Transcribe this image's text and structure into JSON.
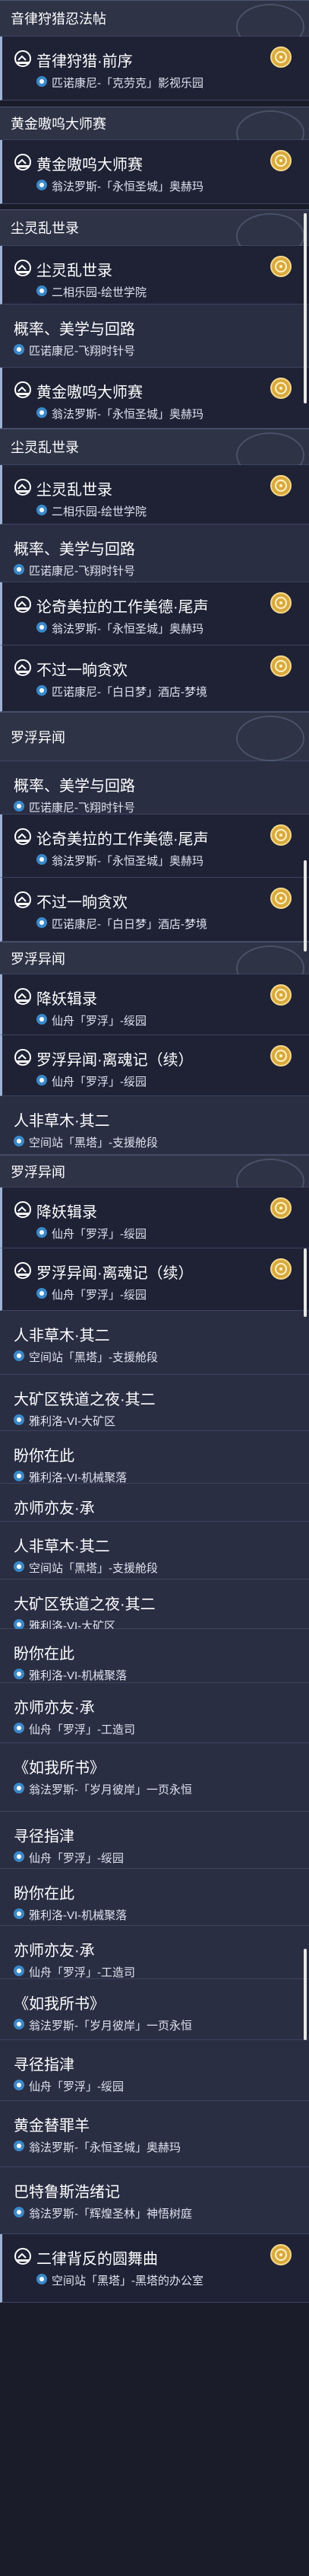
{
  "items": [
    {
      "header": "音律狩猎忍法帖"
    },
    {
      "title": "音律狩猎·前序",
      "location": "匹诺康尼-「克劳克」影视乐园",
      "selected": true
    },
    {
      "header": "黄金嗷呜大师赛"
    },
    {
      "title": "黄金嗷呜大师赛",
      "location": "翁法罗斯-「永恒圣城」奥赫玛",
      "selected": true
    },
    {
      "header": "尘灵乱世录"
    },
    {
      "title": "尘灵乱世录",
      "location": "二相乐园-绘世学院",
      "selected": true
    },
    {
      "title": "概率、美学与回路",
      "location": "匹诺康尼-飞翔时针号",
      "selected": false
    },
    {
      "title": "黄金嗷呜大师赛",
      "location": "翁法罗斯-「永恒圣城」奥赫玛",
      "selected": true
    },
    {
      "header": "尘灵乱世录"
    },
    {
      "title": "尘灵乱世录",
      "location": "二相乐园-绘世学院",
      "selected": true
    },
    {
      "title": "概率、美学与回路",
      "location": "匹诺康尼-飞翔时针号",
      "selected": false
    },
    {
      "title": "论奇美拉的工作美德·尾声",
      "location": "翁法罗斯-「永恒圣城」奥赫玛",
      "selected": true
    },
    {
      "title": "不过一晌贪欢",
      "location": "匹诺康尼-「白日梦」酒店-梦境",
      "selected": true
    },
    {
      "header": "罗浮异闻"
    },
    {
      "title": "概率、美学与回路",
      "location": "匹诺康尼-飞翔时针号",
      "selected": false
    },
    {
      "title": "论奇美拉的工作美德·尾声",
      "location": "翁法罗斯-「永恒圣城」奥赫玛",
      "selected": true
    },
    {
      "title": "不过一晌贪欢",
      "location": "匹诺康尼-「白日梦」酒店-梦境",
      "selected": true
    },
    {
      "header": "罗浮异闻"
    },
    {
      "title": "降妖辑录",
      "location": "仙舟「罗浮」-绥园",
      "selected": true
    },
    {
      "title": "罗浮异闻·离魂记（续）",
      "location": "仙舟「罗浮」-绥园",
      "selected": true
    },
    {
      "title": "人非草木·其二",
      "location": "空间站「黑塔」-支援舱段",
      "selected": false
    },
    {
      "header": "罗浮异闻"
    },
    {
      "title": "降妖辑录",
      "location": "仙舟「罗浮」-绥园",
      "selected": true
    },
    {
      "title": "罗浮异闻·离魂记（续）",
      "location": "仙舟「罗浮」-绥园",
      "selected": true
    },
    {
      "title": "人非草木·其二",
      "location": "空间站「黑塔」-支援舱段",
      "selected": false
    },
    {
      "title": "大矿区铁道之夜·其二",
      "location": "雅利洛-VI-大矿区",
      "selected": false
    },
    {
      "title": "盼你在此",
      "location": "雅利洛-VI-机械聚落",
      "selected": false
    },
    {
      "title": "亦师亦友·承",
      "location": "",
      "selected": false
    },
    {
      "title": "人非草木·其二",
      "location": "空间站「黑塔」-支援舱段",
      "selected": false
    },
    {
      "title": "大矿区铁道之夜·其二",
      "location": "雅利洛-VI-大矿区",
      "selected": false
    },
    {
      "title": "盼你在此",
      "location": "雅利洛-VI-机械聚落",
      "selected": false
    },
    {
      "title": "亦师亦友·承",
      "location": "仙舟「罗浮」-工造司",
      "selected": false
    },
    {
      "title": "《如我所书》",
      "location": "翁法罗斯-「岁月彼岸」一页永恒",
      "selected": false
    },
    {
      "title": "寻径指津",
      "location": "仙舟「罗浮」-绥园",
      "selected": false
    },
    {
      "title": "盼你在此",
      "location": "雅利洛-VI-机械聚落",
      "selected": false
    },
    {
      "title": "亦师亦友·承",
      "location": "仙舟「罗浮」-工造司",
      "selected": false
    },
    {
      "title": "《如我所书》",
      "location": "翁法罗斯-「岁月彼岸」一页永恒",
      "selected": false
    },
    {
      "title": "寻径指津",
      "location": "仙舟「罗浮」-绥园",
      "selected": false
    },
    {
      "title": "黄金替罪羊",
      "location": "翁法罗斯-「永恒圣城」奥赫玛",
      "selected": false
    },
    {
      "title": "巴特鲁斯浩绪记",
      "location": "翁法罗斯-「辉煌圣林」神悟树庭",
      "selected": false
    },
    {
      "title": "二律背反的圆舞曲",
      "location": "空间站「黑塔」-黑塔的办公室",
      "selected": true
    }
  ]
}
